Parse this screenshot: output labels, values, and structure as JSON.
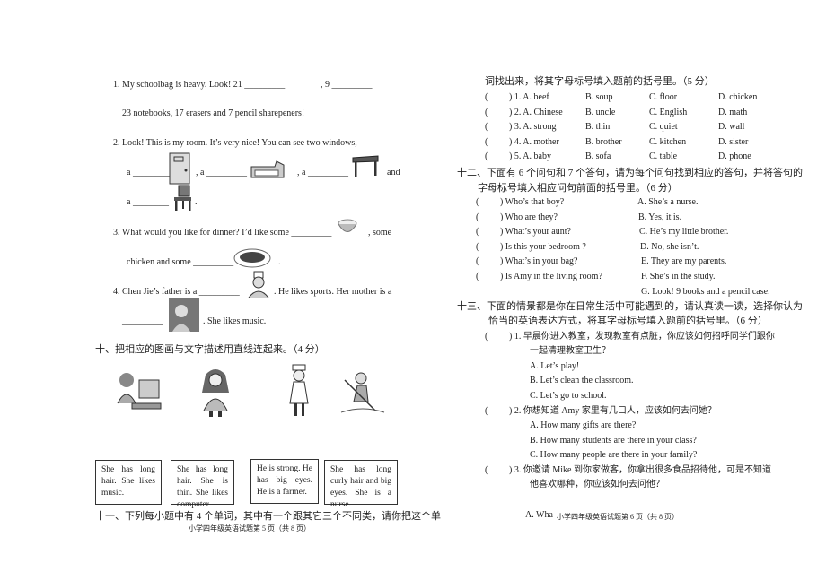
{
  "left_page": {
    "q1": {
      "a": "1. My schoolbag is heavy. Look! 21 _________",
      "b": ", 9 _________",
      "c": "23 notebooks, 17 erasers and 7 pencil sharepeners!"
    },
    "q2": {
      "a": "2. Look! This is my room. It’s very nice! You can see two windows,",
      "b1": "a _________",
      "b2": ", a _________",
      "b3": ", a _________",
      "b4": "and",
      "c": "a ________",
      "c2": "."
    },
    "q3": {
      "a": "3. What would you like for dinner? I’d like some _________",
      "a2": ", some",
      "b": "chicken and some _________",
      "b2": "."
    },
    "q4": {
      "a": "4. Chen Jie’s father is a _________",
      "a2": ". He likes sports. Her mother is a",
      "b": "_________",
      "b2": ". She likes music."
    },
    "section10": "十、把相应的图画与文字描述用直线连起来。（4 分）",
    "boxes": [
      "She has long hair. She likes music.",
      "She has long hair. She is thin. She likes computer",
      "He is strong. He has big eyes. He is a farmer.",
      "She has long curly hair and big eyes. She is a nurse."
    ],
    "section11": "十一、下列每小题中有 4 个单词，其中有一个跟其它三个不同类，请你把这个单",
    "footer": "小学四年级英语试题第 5 页（共 8 页）"
  },
  "right_page": {
    "section11_cont": "词找出来，将其字母标号填入题前的括号里。（5 分）",
    "odd_one_out": [
      {
        "n": ") 1. A. beef",
        "b": "B. soup",
        "c": "C. floor",
        "d": "D. chicken"
      },
      {
        "n": ") 2. A. Chinese",
        "b": "B. uncle",
        "c": "C. English",
        "d": "D. math"
      },
      {
        "n": ") 3. A. strong",
        "b": "B. thin",
        "c": "C. quiet",
        "d": "D. wall"
      },
      {
        "n": ") 4. A. mother",
        "b": "B. brother",
        "c": "C. kitchen",
        "d": "D. sister"
      },
      {
        "n": ") 5. A. baby",
        "b": "B. sofa",
        "c": "C. table",
        "d": "D. phone"
      }
    ],
    "section12": "十二、下面有 6 个问句和 7 个答句，请为每个问句找到相应的答句，并将答句的",
    "section12_cont": "字母标号填入相应问句前面的括号里。（6 分）",
    "questions": [
      ") Who’s that boy?",
      ") Who are they?",
      ") What’s your aunt?",
      ") Is this your bedroom ?",
      ") What’s in your bag?",
      ") Is Amy in the living room?"
    ],
    "answers": [
      "A. She’s a nurse.",
      "B. Yes, it is.",
      "C. He’s my little brother.",
      "D. No, she isn’t.",
      "E. They are my parents.",
      "F. She’s in the study.",
      "G. Look! 9 books and a pencil case."
    ],
    "section13": "十三、下面的情景都是你在日常生活中可能遇到的，请认真读一读，选择你认为",
    "section13_cont": "恰当的英语表达方式，将其字母标号填入题前的括号里。（6 分）",
    "s1": {
      "q": ") 1. 早晨你进入教室，发现教室有点脏，你应该如何招呼同学们跟你",
      "q2": "一起清理教室卫生？",
      "a": "A.  Let’s play!",
      "b": "B.  Let’s clean the classroom.",
      "c": "C.  Let’s go to school."
    },
    "s2": {
      "q": ") 2. 你想知道 Amy 家里有几口人，应该如何去问她？",
      "a": "A.  How many gifts are there?",
      "b": "B.  How many students are there in your class?",
      "c": "C.  How many people are there in your family?"
    },
    "s3": {
      "q": ") 3. 你邀请 Mike 到你家做客，你拿出很多食品招待他，可是不知道",
      "q2": "他喜欢哪种，你应该如何去问他？",
      "a": "A. Wha"
    },
    "paren": "(",
    "footer": "小学四年级英语试题第 6 页（共 8 页）"
  }
}
